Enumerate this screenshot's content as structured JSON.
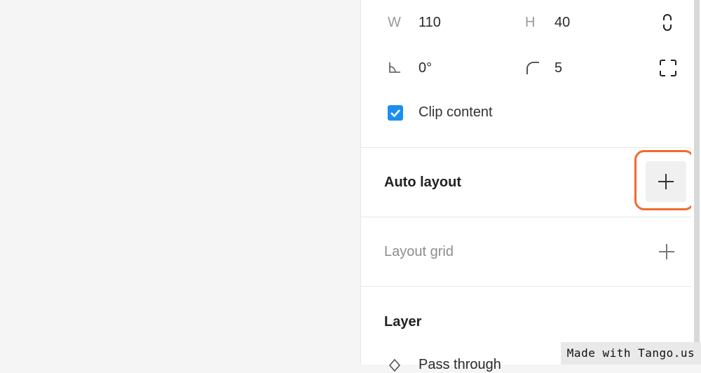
{
  "dimensions": {
    "w_label": "W",
    "w_value": "110",
    "h_label": "H",
    "h_value": "40"
  },
  "transform": {
    "rotation_value": "0°",
    "radius_value": "5"
  },
  "clip_content": {
    "label": "Clip content",
    "checked": true
  },
  "sections": {
    "auto_layout": "Auto layout",
    "layout_grid": "Layout grid",
    "layer": "Layer",
    "layer_blend": "Pass through"
  },
  "watermark": "Made with Tango.us",
  "colors": {
    "accent_blue": "#1c8ef2",
    "highlight_orange": "#f26a2e"
  },
  "icons": {
    "constrain": "link-proportions-icon",
    "rotation": "rotation-angle-icon",
    "radius": "corner-radius-icon",
    "independent_corners": "independent-corners-icon",
    "add": "plus-icon"
  }
}
